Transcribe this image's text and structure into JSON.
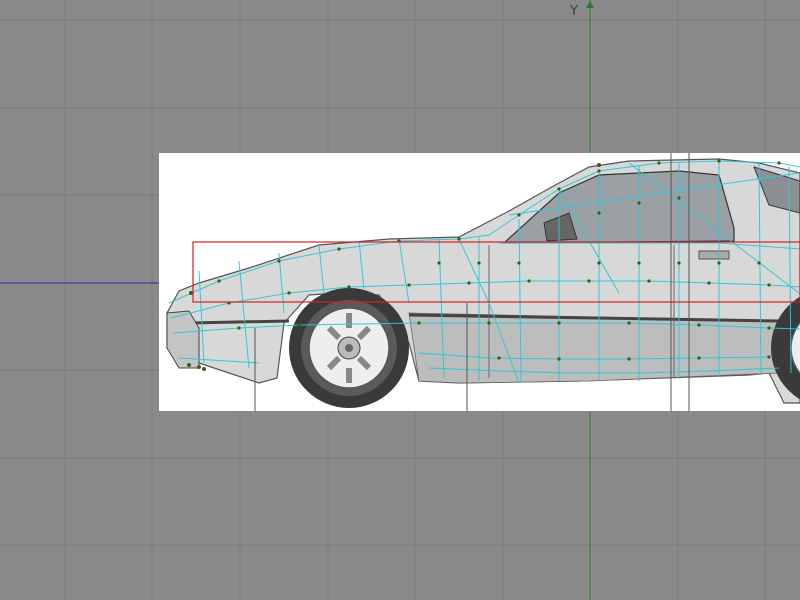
{
  "viewport": {
    "name": "side-view",
    "background": "#8a8a8a",
    "grid_color": "#7a7a7a",
    "y_axis_color": "#2e7d2e",
    "x_axis_color": "#2a2aa8",
    "y_axis_label": "Y"
  },
  "blueprint": {
    "subject": "car-side-profile",
    "wireframe_color": "#2cc7d6",
    "vertex_color": "#3a5a1a",
    "selection_color": "#d42020"
  }
}
